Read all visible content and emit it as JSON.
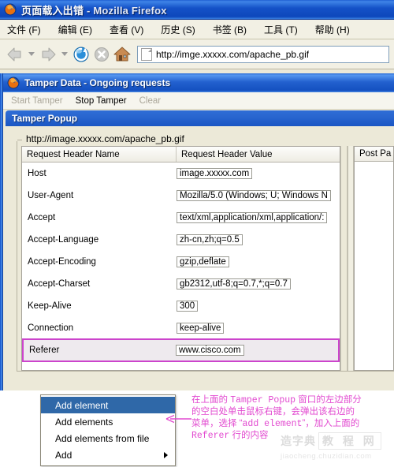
{
  "browser": {
    "title_main": "页面载入出错",
    "title_suffix": " - Mozilla Firefox",
    "app_icon": "firefox-icon",
    "menus": [
      {
        "label": "文件 (F)",
        "name": "menu-file"
      },
      {
        "label": "编辑 (E)",
        "name": "menu-edit"
      },
      {
        "label": "查看 (V)",
        "name": "menu-view"
      },
      {
        "label": "历史 (S)",
        "name": "menu-history"
      },
      {
        "label": "书签 (B)",
        "name": "menu-bookmarks"
      },
      {
        "label": "工具 (T)",
        "name": "menu-tools"
      },
      {
        "label": "帮助 (H)",
        "name": "menu-help"
      }
    ],
    "toolbar": {
      "back": "back-arrow-icon",
      "forward": "forward-arrow-icon",
      "reload": "reload-icon",
      "stop": "stop-icon",
      "home": "home-icon"
    },
    "address": {
      "value": "http://imge.xxxxx.com/apache_pb.gif",
      "placeholder": "",
      "favicon": "page-icon"
    }
  },
  "tamper": {
    "window_title": "Tamper Data - Ongoing requests",
    "window_icon": "firefox-icon",
    "toolbar": {
      "start": {
        "label": "Start Tamper",
        "enabled": false
      },
      "stop": {
        "label": "Stop Tamper",
        "enabled": true
      },
      "clear": {
        "label": "Clear",
        "enabled": false
      }
    },
    "popup_title": "Tamper Popup",
    "request_url": "http://image.xxxxx.com/apache_pb.gif",
    "table": {
      "columns": [
        "Request Header Name",
        "Request Header Value"
      ],
      "rows": [
        {
          "name": "Host",
          "value": "image.xxxxx.com",
          "highlighted": false
        },
        {
          "name": "User-Agent",
          "value": "Mozilla/5.0 (Windows; U; Windows N",
          "highlighted": false
        },
        {
          "name": "Accept",
          "value": "text/xml,application/xml,application/:",
          "highlighted": false
        },
        {
          "name": "Accept-Language",
          "value": "zh-cn,zh;q=0.5",
          "highlighted": false
        },
        {
          "name": "Accept-Encoding",
          "value": "gzip,deflate",
          "highlighted": false
        },
        {
          "name": "Accept-Charset",
          "value": "gb2312,utf-8;q=0.7,*;q=0.7",
          "highlighted": false
        },
        {
          "name": "Keep-Alive",
          "value": "300",
          "highlighted": false
        },
        {
          "name": "Connection",
          "value": "keep-alive",
          "highlighted": false
        },
        {
          "name": "Referer",
          "value": "www.cisco.com",
          "highlighted": true
        }
      ]
    },
    "post_panel": {
      "column": "Post Pa"
    },
    "highlight_color": "#cc44cc"
  },
  "context_menu": {
    "items": [
      {
        "label": "Add element",
        "selected": true,
        "submenu": false
      },
      {
        "label": "Add elements",
        "selected": false,
        "submenu": false
      },
      {
        "label": "Add elements from file",
        "selected": false,
        "submenu": false
      },
      {
        "label": "Add",
        "selected": false,
        "submenu": true
      }
    ],
    "selection_color": "#2f68a8"
  },
  "annotation": {
    "color": "#e24ad0",
    "line1_a": "在上面的 ",
    "line1_b": "Tamper Popup",
    "line1_c": " 窗口的左边部分",
    "line2": "的空白处单击鼠标右键，会弹出该右边的",
    "line3_a": "菜单，选择 “",
    "line3_b": "add element",
    "line3_c": "”，加入上面的",
    "line4_a": "Referer",
    "line4_b": " 行的内容",
    "arrow": "left-arrow-annotation"
  },
  "watermark": {
    "text_left": "造字典",
    "text_right": "教 程 网",
    "url": "jiaocheng.chuzidian.com"
  }
}
